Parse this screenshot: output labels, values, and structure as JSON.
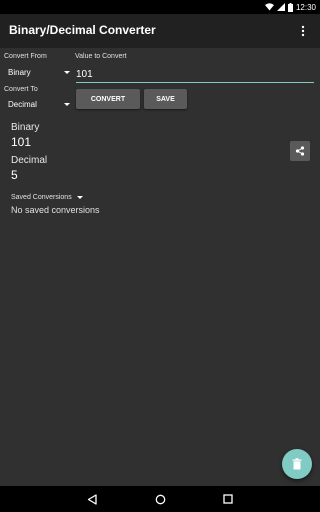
{
  "status_bar": {
    "time": "12:30",
    "icons": [
      "wifi-icon",
      "signal-icon",
      "battery-icon"
    ]
  },
  "app_bar": {
    "title": "Binary/Decimal Converter",
    "menu_icon": "more-vert-icon"
  },
  "form": {
    "convert_from_label": "Convert From",
    "convert_from_value": "Binary",
    "convert_to_label": "Convert To",
    "convert_to_value": "Decimal",
    "value_label": "Value to Convert",
    "value_input": "101",
    "convert_button": "CONVERT",
    "save_button": "SAVE"
  },
  "results": {
    "input_label": "Binary",
    "input_value": "101",
    "output_label": "Decimal",
    "output_value": "5",
    "share_icon": "share-icon"
  },
  "saved": {
    "toggle_label": "Saved Conversions",
    "empty_text": "No saved conversions"
  },
  "fab": {
    "icon": "delete-icon"
  },
  "nav_bar": {
    "icons": [
      "back-icon",
      "home-icon",
      "recents-icon"
    ]
  },
  "colors": {
    "background": "#303030",
    "app_bar": "#212121",
    "accent": "#80cbc4",
    "button": "#5a5a5a"
  }
}
